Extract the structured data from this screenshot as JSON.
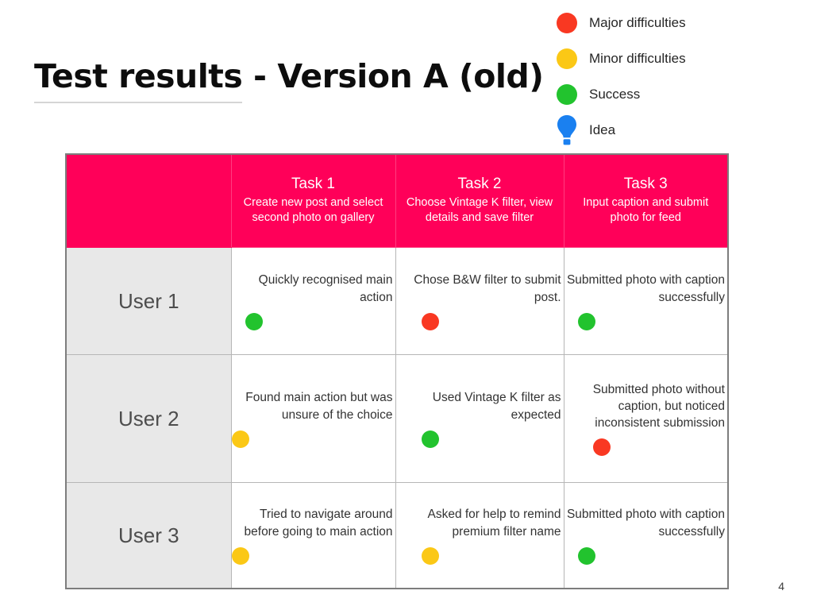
{
  "slide": {
    "title": "Test results - Version A (old)",
    "page_number": "4",
    "background_color": "#FFFFFF"
  },
  "legend": {
    "items": [
      {
        "label": "Major difficulties",
        "icon": "red-circle-icon",
        "color": "#F93822",
        "shape": "circle"
      },
      {
        "label": "Minor difficulties",
        "icon": "yellow-circle-icon",
        "color": "#FBC816",
        "shape": "circle"
      },
      {
        "label": "Success",
        "icon": "green-circle-icon",
        "color": "#22C32E",
        "shape": "circle"
      },
      {
        "label": "Idea",
        "icon": "lightbulb-icon",
        "color": "#1A80F0",
        "shape": "bulb"
      }
    ]
  },
  "table": {
    "header_color": "#FF0059",
    "user_column_color": "#E8E8E8",
    "columns": [
      {
        "title": "",
        "subtitle": ""
      },
      {
        "title": "Task 1",
        "subtitle": "Create new post and select second photo on gallery"
      },
      {
        "title": "Task 2",
        "subtitle": "Choose Vintage K filter, view details and save filter"
      },
      {
        "title": "Task 3",
        "subtitle": "Input caption and submit photo for feed"
      }
    ],
    "rows": [
      {
        "user": "User 1",
        "cells": [
          {
            "text": "Quickly recognised main action",
            "status": "Success",
            "color": "#22C32E"
          },
          {
            "text": "Chose B&W filter to submit post.",
            "status": "Major difficulties",
            "color": "#F93822"
          },
          {
            "text": "Submitted photo with caption successfully",
            "status": "Success",
            "color": "#22C32E"
          }
        ]
      },
      {
        "user": "User 2",
        "cells": [
          {
            "text": "Found main action but was unsure of the choice",
            "status": "Minor difficulties",
            "color": "#FBC816"
          },
          {
            "text": "Used Vintage K filter as expected",
            "status": "Success",
            "color": "#22C32E"
          },
          {
            "text": "Submitted photo without caption, but noticed inconsistent submission",
            "status": "Major difficulties",
            "color": "#F93822"
          }
        ]
      },
      {
        "user": "User 3",
        "cells": [
          {
            "text": "Tried to navigate around before going to main action",
            "status": "Minor difficulties",
            "color": "#FBC816"
          },
          {
            "text": "Asked for help to remind premium filter name",
            "status": "Minor difficulties",
            "color": "#FBC816"
          },
          {
            "text": "Submitted photo with caption successfully",
            "status": "Success",
            "color": "#22C32E"
          }
        ]
      }
    ]
  }
}
